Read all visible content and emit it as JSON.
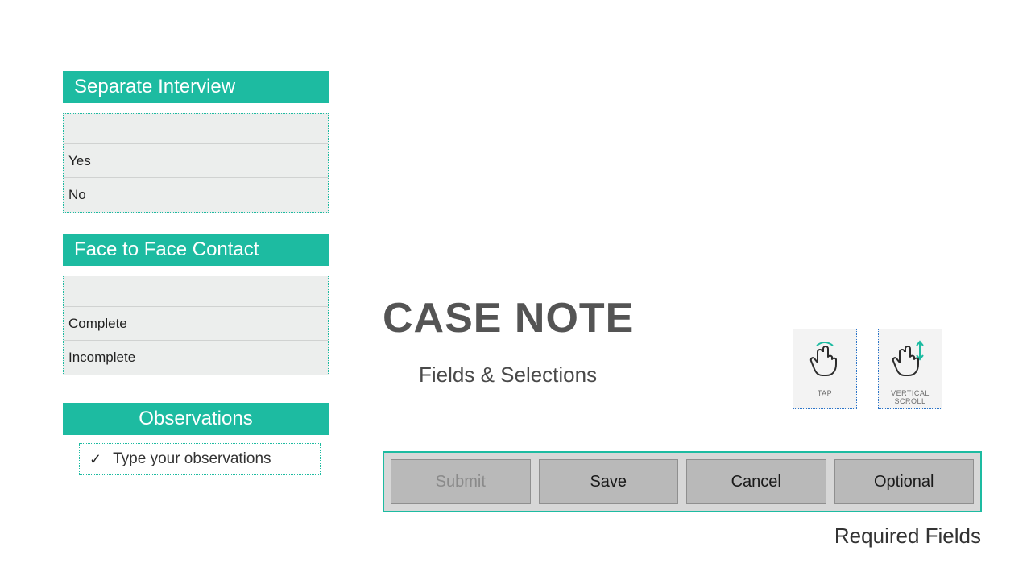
{
  "sections": {
    "separate_interview": {
      "title": "Separate Interview",
      "options": [
        "Yes",
        "No"
      ]
    },
    "face_to_face": {
      "title": "Face to Face Contact",
      "options": [
        "Complete",
        "Incomplete"
      ]
    },
    "observations": {
      "title": "Observations",
      "placeholder": "Type your observations"
    }
  },
  "main": {
    "title": "CASE NOTE",
    "subtitle": "Fields & Selections"
  },
  "gestures": {
    "tap": "TAP",
    "scroll": "VERTICAL SCROLL"
  },
  "buttons": {
    "submit": "Submit",
    "save": "Save",
    "cancel": "Cancel",
    "optional": "Optional"
  },
  "footer": {
    "required": "Required Fields"
  },
  "colors": {
    "accent": "#1dbba1"
  }
}
